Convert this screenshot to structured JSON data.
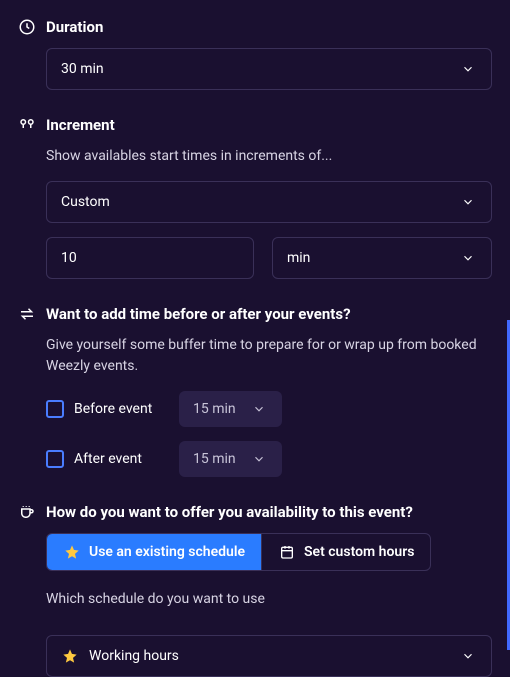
{
  "duration": {
    "label": "Duration",
    "selected": "30 min"
  },
  "increment": {
    "label": "Increment",
    "subtext": "Show availables start times in increments of...",
    "type_selected": "Custom",
    "value": "10",
    "unit_selected": "min"
  },
  "buffer": {
    "label": "Want to add time before or after your events?",
    "subtext": "Give yourself some buffer time to prepare for or wrap up from booked Weezly events.",
    "before_label": "Before event",
    "before_value": "15 min",
    "after_label": "After event",
    "after_value": "15 min"
  },
  "availability": {
    "label": "How do you want to offer you availability to this event?",
    "tab_existing": "Use an existing schedule",
    "tab_custom": "Set custom hours",
    "which_label": "Which schedule do you want to use",
    "schedule_selected": "Working hours"
  }
}
